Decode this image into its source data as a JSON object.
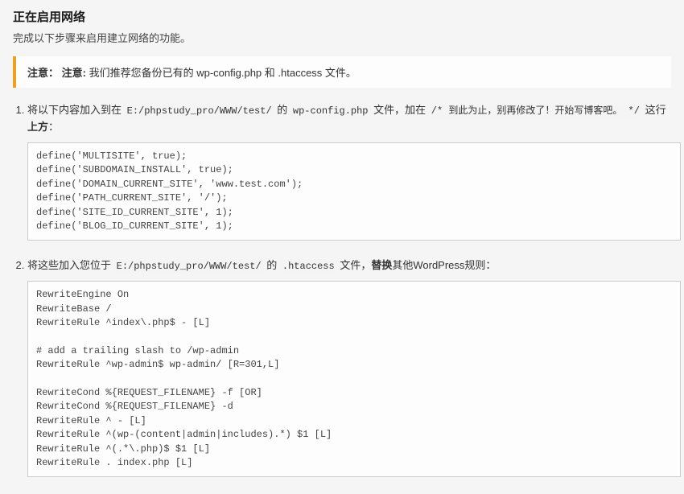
{
  "header": {
    "title": "正在启用网络",
    "subtitle": "完成以下步骤来启用建立网络的功能。"
  },
  "notice": {
    "label_bold1": "注意：",
    "label_bold2": "注意:",
    "text": " 我们推荐您备份已有的 wp-config.php 和 .htaccess 文件。"
  },
  "step1": {
    "prefix": "将以下内容加入到在 ",
    "path": "E:/phpstudy_pro/WWW/test/",
    "mid1": " 的 ",
    "file": "wp-config.php",
    "mid2": " 文件，加在 ",
    "comment": "/* 到此为止，别再修改了！开始写博客吧。 */",
    "suffix1": " 这行",
    "suffix_bold": "上方",
    "suffix2": "：",
    "code": "define('MULTISITE', true);\ndefine('SUBDOMAIN_INSTALL', true);\ndefine('DOMAIN_CURRENT_SITE', 'www.test.com');\ndefine('PATH_CURRENT_SITE', '/');\ndefine('SITE_ID_CURRENT_SITE', 1);\ndefine('BLOG_ID_CURRENT_SITE', 1);"
  },
  "step2": {
    "prefix": "将这些加入您位于 ",
    "path": "E:/phpstudy_pro/WWW/test/",
    "mid1": " 的 ",
    "file": ".htaccess",
    "mid2": " 文件，",
    "bold": "替换",
    "suffix": "其他WordPress规则：",
    "code": "RewriteEngine On\nRewriteBase /\nRewriteRule ^index\\.php$ - [L]\n\n# add a trailing slash to /wp-admin\nRewriteRule ^wp-admin$ wp-admin/ [R=301,L]\n\nRewriteCond %{REQUEST_FILENAME} -f [OR]\nRewriteCond %{REQUEST_FILENAME} -d\nRewriteRule ^ - [L]\nRewriteRule ^(wp-(content|admin|includes).*) $1 [L]\nRewriteRule ^(.*\\.php)$ $1 [L]\nRewriteRule . index.php [L]"
  }
}
